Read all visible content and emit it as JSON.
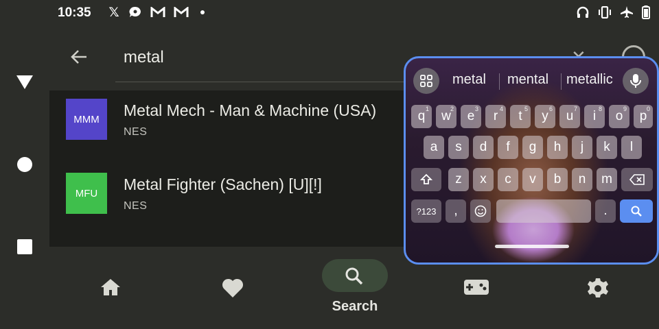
{
  "status_bar": {
    "time": "10:35",
    "notification_icons": [
      "x-logo-icon",
      "chat-icon",
      "gmail-icon",
      "gmail-icon",
      "more-dot-icon"
    ],
    "system_icons": [
      "headphones-icon",
      "vibrate-icon",
      "airplane-icon",
      "battery-icon"
    ]
  },
  "system_nav": {
    "buttons": [
      "back-triangle-icon",
      "home-circle-icon",
      "recents-square-icon"
    ]
  },
  "search": {
    "value": "metal",
    "clear_icon": "close-icon",
    "help_icon": "help-icon"
  },
  "results": [
    {
      "thumb_text": "MMM",
      "thumb_color": "#5445c9",
      "title": "Metal Mech - Man & Machine (USA)",
      "platform": "NES"
    },
    {
      "thumb_text": "MFU",
      "thumb_color": "#3fbf4c",
      "title": "Metal Fighter (Sachen) [U][!]",
      "platform": "NES"
    }
  ],
  "bottom_nav": {
    "items": [
      {
        "icon": "home-icon"
      },
      {
        "icon": "heart-icon"
      },
      {
        "icon": "search-icon",
        "label": "Search",
        "selected": true
      },
      {
        "icon": "gamepad-icon"
      },
      {
        "icon": "settings-icon"
      }
    ]
  },
  "keyboard": {
    "suggestions": [
      "metal",
      "mental",
      "metallic"
    ],
    "row1": [
      {
        "k": "q",
        "h": "1"
      },
      {
        "k": "w",
        "h": "2"
      },
      {
        "k": "e",
        "h": "3"
      },
      {
        "k": "r",
        "h": "4"
      },
      {
        "k": "t",
        "h": "5"
      },
      {
        "k": "y",
        "h": "6"
      },
      {
        "k": "u",
        "h": "7"
      },
      {
        "k": "i",
        "h": "8"
      },
      {
        "k": "o",
        "h": "9"
      },
      {
        "k": "p",
        "h": "0"
      }
    ],
    "row2": [
      "a",
      "s",
      "d",
      "f",
      "g",
      "h",
      "j",
      "k",
      "l"
    ],
    "row3": [
      "z",
      "x",
      "c",
      "v",
      "b",
      "n",
      "m"
    ],
    "symbols_label": "?123",
    "comma": ",",
    "period": ".",
    "accent_color": "#5b8ef0"
  }
}
